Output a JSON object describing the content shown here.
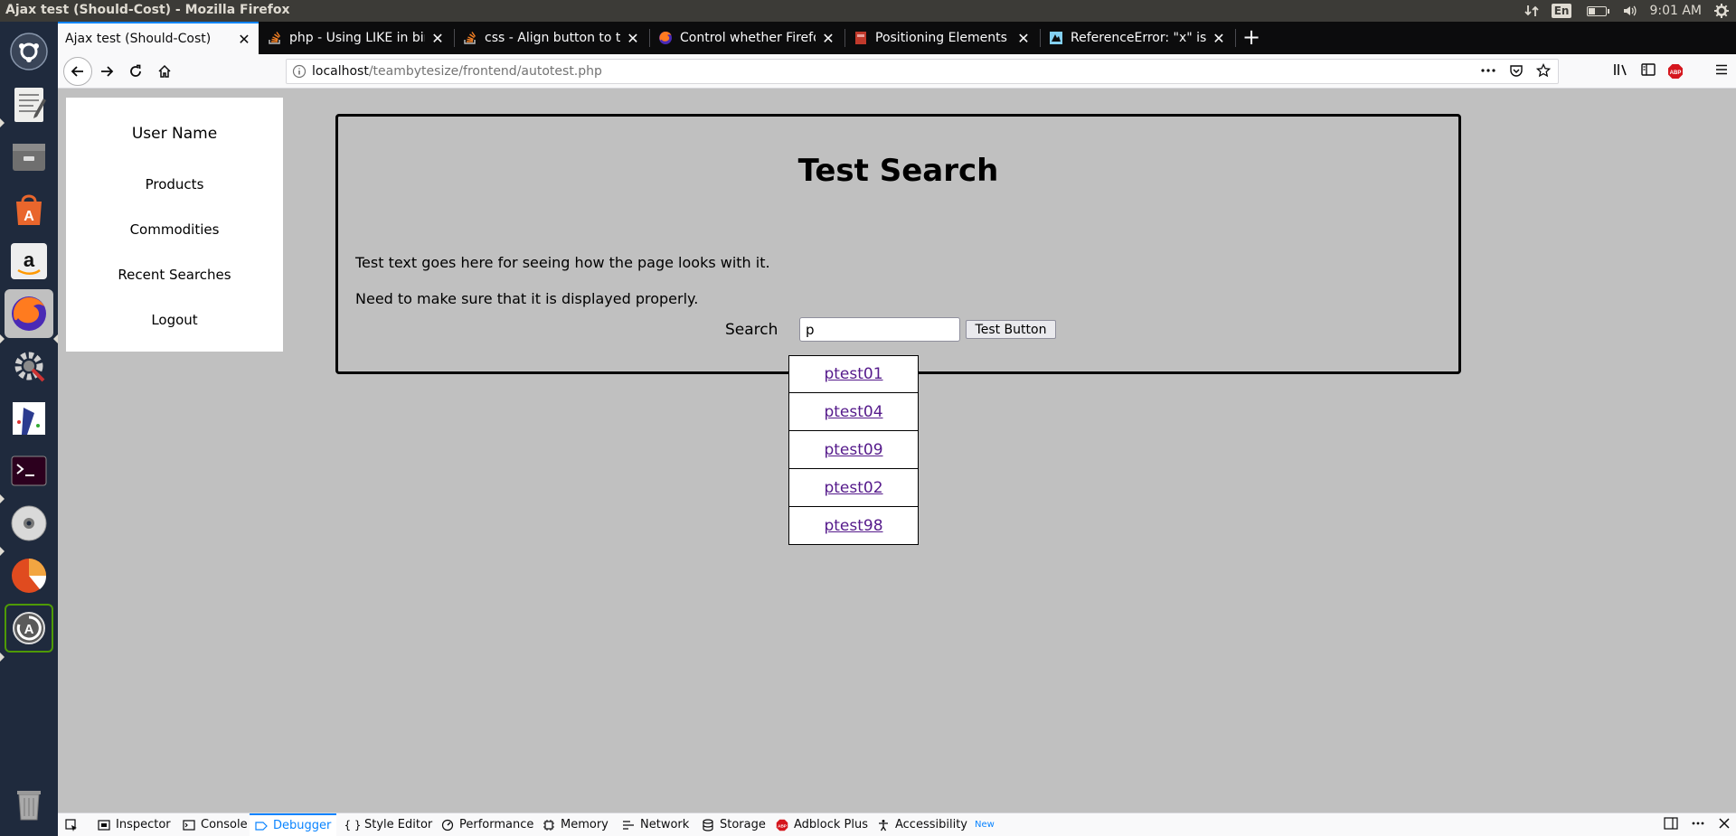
{
  "system": {
    "window_title": "Ajax test (Should-Cost) - Mozilla Firefox",
    "lang": "En",
    "time": "9:01 AM",
    "battery_level": 0.35,
    "launcher_apps": [
      "dash-icon",
      "text-editor-icon",
      "files-icon",
      "software-center-icon",
      "amazon-icon",
      "firefox-icon",
      "system-settings-icon",
      "gimp-icon",
      "terminal-icon",
      "dvd-icon",
      "disk-usage-icon",
      "software-updater-icon",
      "trash-icon"
    ]
  },
  "browser": {
    "tabs": [
      {
        "label": "Ajax test (Should-Cost)",
        "active": true
      },
      {
        "label": "php - Using LIKE in bindP"
      },
      {
        "label": "css - Align button to the"
      },
      {
        "label": "Control whether Firefox"
      },
      {
        "label": "Positioning Elements on"
      },
      {
        "label": "ReferenceError: \"x\" is no"
      }
    ],
    "url_host": "localhost",
    "url_path": "/teambytesize/frontend/autotest.php",
    "abp_badge": "ABP"
  },
  "page": {
    "sidebar": {
      "user_name": "User Name",
      "links": [
        "Products",
        "Commodities",
        "Recent Searches",
        "Logout"
      ]
    },
    "title": "Test Search",
    "paragraphs": [
      "Test text goes here for seeing how the page looks with it.",
      "Need to make sure that it is displayed properly."
    ],
    "search_label": "Search",
    "search_value": "p",
    "test_button": "Test Button",
    "suggestions": [
      "ptest01",
      "ptest04",
      "ptest09",
      "ptest02",
      "ptest98"
    ]
  },
  "devtools": {
    "tabs": [
      {
        "label": "Inspector",
        "icon": "inspector-icon"
      },
      {
        "label": "Console",
        "icon": "console-icon"
      },
      {
        "label": "Debugger",
        "icon": "debugger-icon",
        "selected": true
      },
      {
        "label": "Style Editor",
        "icon": "style-editor-icon"
      },
      {
        "label": "Performance",
        "icon": "performance-icon"
      },
      {
        "label": "Memory",
        "icon": "memory-icon"
      },
      {
        "label": "Network",
        "icon": "network-icon"
      },
      {
        "label": "Storage",
        "icon": "storage-icon"
      },
      {
        "label": "Adblock Plus",
        "icon": "adblock-plus-icon"
      },
      {
        "label": "Accessibility",
        "icon": "accessibility-icon",
        "badge": "New"
      }
    ]
  }
}
